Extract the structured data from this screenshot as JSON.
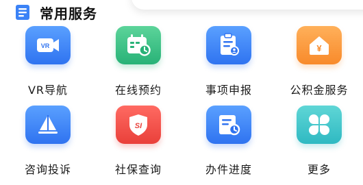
{
  "section": {
    "title": "常用服务"
  },
  "services": [
    {
      "label": "VR导航",
      "icon": "vr-camera-icon",
      "color": "#3b82f6",
      "glyph": "VR"
    },
    {
      "label": "在线预约",
      "icon": "calendar-clock-icon",
      "color": "#2fbf7f"
    },
    {
      "label": "事项申报",
      "icon": "clipboard-person-icon",
      "color": "#3b82f6"
    },
    {
      "label": "公积金服务",
      "icon": "house-yuan-icon",
      "color": "#f7913a",
      "glyph": "¥"
    },
    {
      "label": "咨询投诉",
      "icon": "paper-plane-icon",
      "color": "#3b82f6"
    },
    {
      "label": "社保查询",
      "icon": "si-shield-icon",
      "color": "#ee4a43",
      "glyph": "SI"
    },
    {
      "label": "办件进度",
      "icon": "document-clock-icon",
      "color": "#3b82f6"
    },
    {
      "label": "更多",
      "icon": "clover-grid-icon",
      "color": "#36c2c8"
    }
  ]
}
